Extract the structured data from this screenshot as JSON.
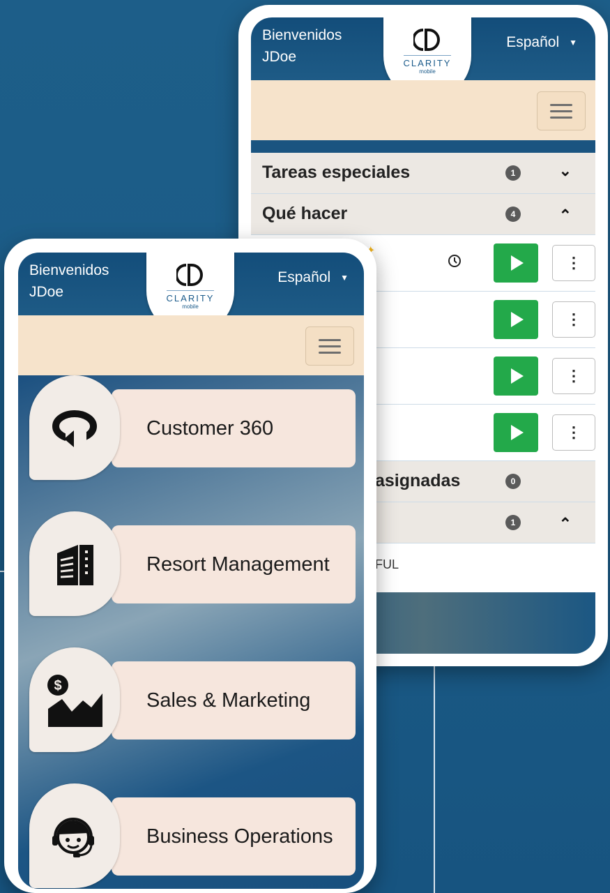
{
  "app": {
    "welcome_line1": "Bienvenidos",
    "welcome_line2": "JDoe",
    "language": "Español",
    "logo_word": "CLARITY",
    "logo_sub": "mobile"
  },
  "back_screen": {
    "sections": [
      {
        "title": "Tareas especiales",
        "count": "1",
        "state": "collapsed"
      },
      {
        "title": "Qué hacer",
        "count": "4",
        "state": "expanded"
      }
    ],
    "unassigned_fragment": "asignadas",
    "unassigned_count": "0",
    "last_section_count": "1",
    "last_fragment": "FUL"
  },
  "front_screen": {
    "tiles": [
      {
        "label": "Customer 360",
        "icon": "rotate-360-icon"
      },
      {
        "label": "Resort Management",
        "icon": "building-icon"
      },
      {
        "label": "Sales & Marketing",
        "icon": "sales-chart-icon"
      },
      {
        "label": "Business Operations",
        "icon": "headset-agent-icon"
      }
    ]
  },
  "colors": {
    "background": "#1b5c87",
    "header": "#134d7a",
    "sub_bar": "#f6e3cb",
    "play_green": "#23a94a",
    "tile": "#f6e6dd"
  }
}
